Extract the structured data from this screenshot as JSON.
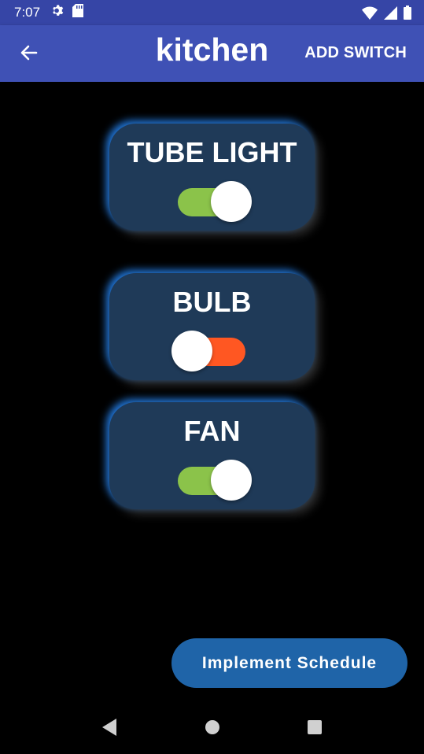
{
  "status": {
    "time": "7:07"
  },
  "appbar": {
    "title": "kitchen",
    "action_label": "ADD SWITCH"
  },
  "switches": [
    {
      "label": "TUBE LIGHT",
      "state": "on",
      "track_color": "#8bc34a"
    },
    {
      "label": "BULB",
      "state": "off",
      "track_color": "#ff5722"
    },
    {
      "label": "FAN",
      "state": "on",
      "track_color": "#8bc34a"
    }
  ],
  "fab": {
    "label": "Implement Schedule"
  },
  "colors": {
    "appbar": "#3f51b5",
    "statusbar": "#3645a6",
    "card": "#1f3a58",
    "card_glow": "#2e8cff",
    "fab": "#1f64a8"
  },
  "icons": {
    "back": "arrow-left-icon",
    "settings": "gear-icon",
    "sd": "sd-card-icon",
    "wifi": "wifi-icon",
    "signal": "signal-icon",
    "battery": "battery-icon"
  }
}
